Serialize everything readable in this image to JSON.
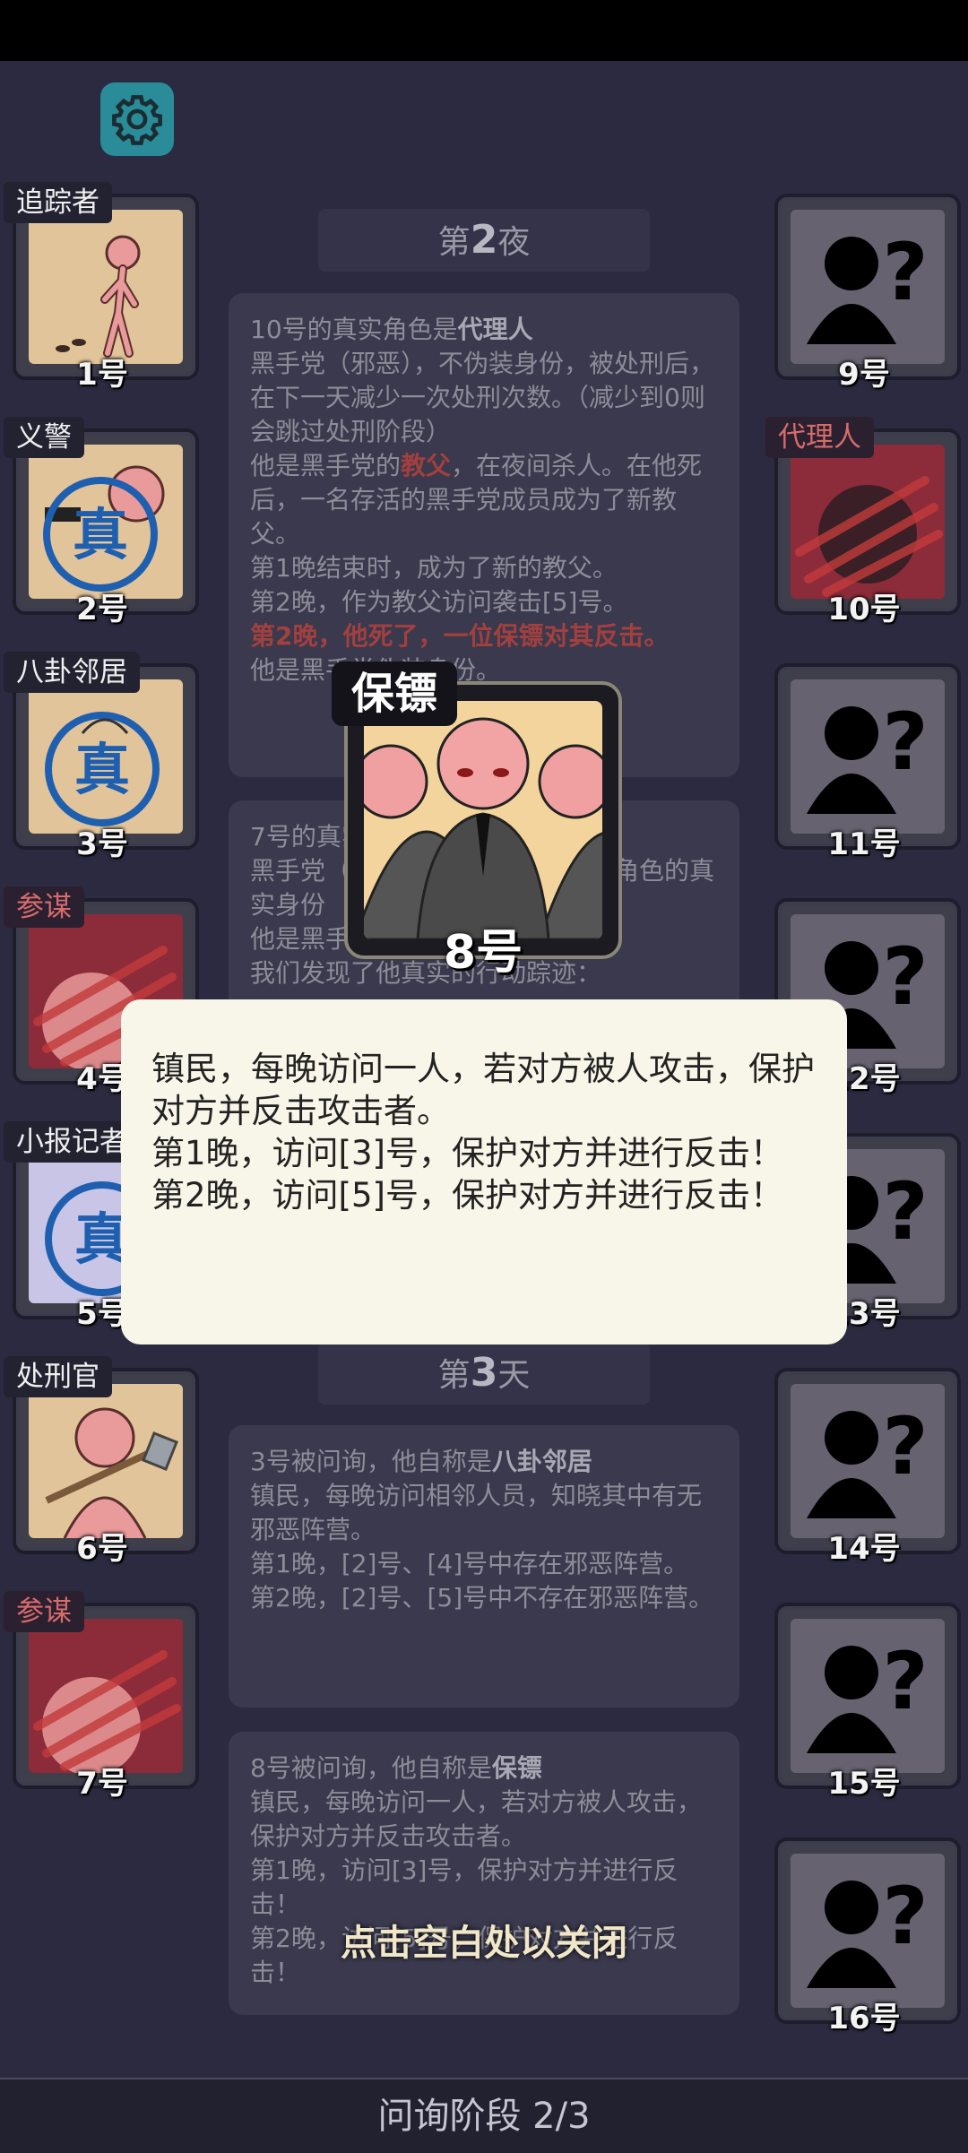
{
  "settings_icon": "gear-icon",
  "left_players": [
    {
      "role": "追踪者",
      "number": "1号",
      "art": "stickman-tracker",
      "mark": ""
    },
    {
      "role": "义警",
      "number": "2号",
      "art": "stickman-gun",
      "mark": "真"
    },
    {
      "role": "八卦邻居",
      "number": "3号",
      "art": "neighbor",
      "mark": "真"
    },
    {
      "role": "参谋",
      "number": "4号",
      "art": "advisor-dead",
      "mark": ""
    },
    {
      "role": "小报记者",
      "number": "5号",
      "art": "reporter",
      "mark": "真"
    },
    {
      "role": "处刑官",
      "number": "6号",
      "art": "executioner-axe",
      "mark": ""
    },
    {
      "role": "参谋",
      "number": "7号",
      "art": "advisor-dead",
      "mark": ""
    }
  ],
  "right_players": [
    {
      "role": "",
      "number": "9号"
    },
    {
      "role": "代理人",
      "number": "10号"
    },
    {
      "role": "",
      "number": "11号"
    },
    {
      "role": "",
      "number": "12号"
    },
    {
      "role": "",
      "number": "13号"
    },
    {
      "role": "",
      "number": "14号"
    },
    {
      "role": "",
      "number": "15号"
    },
    {
      "role": "",
      "number": "16号"
    }
  ],
  "night2": {
    "label_pre": "第",
    "label_num": "2",
    "label_post": "夜",
    "entry1": {
      "line1_pre": "10号的真实角色是",
      "line1_role": "代理人",
      "body1": "黑手党（邪恶），不伪装身份，被处刑后，在下一天减少一次处刑次数。（减少到0则会跳过处刑阶段）",
      "line2_pre": "他是黑手党的",
      "line2_hl": "教父",
      "line2_post": "，在夜间杀人。在他死后，一名存活的黑手党成员成为了新教父。",
      "line3": "第1晚结束时，成为了新的教父。",
      "line4": "第2晚，作为教父访问袭击[5]号。",
      "line5_red": "第2晚，他死了，一位保镖对其反击。",
      "line6": "他是黑手党伪装身份。"
    },
    "entry2": {
      "line1": "7号的真实角色是",
      "line2": "黑手党（邪恶），会伪装，其伪装角色的真实身份",
      "line3": "他是黑手党成员",
      "line4": "我们发现了他真实的行动踪迹："
    }
  },
  "day3": {
    "label_pre": "第",
    "label_num": "3",
    "label_post": "天",
    "entry1": {
      "line1_pre": "3号被问询，他自称是",
      "line1_role": "八卦邻居",
      "body": "镇民，每晚访问相邻人员，知晓其中有无邪恶阵营。",
      "night1": "第1晚，[2]号、[4]号中存在邪恶阵营。",
      "night2": "第2晚，[2]号、[5]号中不存在邪恶阵营。"
    },
    "entry2": {
      "line1_pre": "8号被问询，他自称是",
      "line1_role": "保镖",
      "body": "镇民，每晚访问一人，若对方被人攻击，保护对方并反击攻击者。",
      "night1": "第1晚，访问[3]号，保护对方并进行反击！",
      "night2": "第2晚，访问[5]号，保护对方并进行反击！"
    }
  },
  "popup": {
    "role_title": "保镖",
    "player_number": "8号",
    "art": "bodyguards",
    "line1": "镇民，每晚访问一人，若对方被人攻击，保护对方并反击攻击者。",
    "line2": "第1晚，访问[3]号，保护对方并进行反击！",
    "line3": "第2晚，访问[5]号，保护对方并进行反击！"
  },
  "close_hint": "点击空白处以关闭",
  "phase": "问询阶段 2/3",
  "colors": {
    "background": "#2b2a40",
    "gear": "#2a8c98",
    "popup": "#f8f6e8",
    "evil_red": "#a2403f"
  }
}
